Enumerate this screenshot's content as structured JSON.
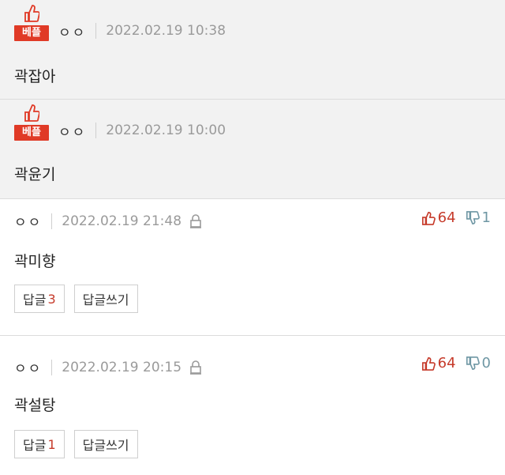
{
  "comments": [
    {
      "badge": "베플",
      "author": "ㅇㅇ",
      "date": "2022.02.19 10:38",
      "text": "곽잡아"
    },
    {
      "badge": "베플",
      "author": "ㅇㅇ",
      "date": "2022.02.19 10:00",
      "text": "곽윤기"
    },
    {
      "author": "ㅇㅇ",
      "date": "2022.02.19 21:48",
      "text": "곽미향",
      "likes": "64",
      "dislikes": "1",
      "reply_label": "답글",
      "reply_count": "3",
      "write_reply_label": "답글쓰기"
    },
    {
      "author": "ㅇㅇ",
      "date": "2022.02.19 20:15",
      "text": "곽설탕",
      "likes": "64",
      "dislikes": "0",
      "reply_label": "답글",
      "reply_count": "1",
      "write_reply_label": "답글쓰기"
    }
  ],
  "colors": {
    "badge": "#e03a26",
    "like": "#c63a2a",
    "dislike": "#6f97a4",
    "best_bg": "#f2f2f2"
  },
  "icons": {
    "badge": "thumbs-up-icon",
    "like": "thumbs-up-icon",
    "dislike": "thumbs-down-icon",
    "lock": "lock-icon"
  }
}
